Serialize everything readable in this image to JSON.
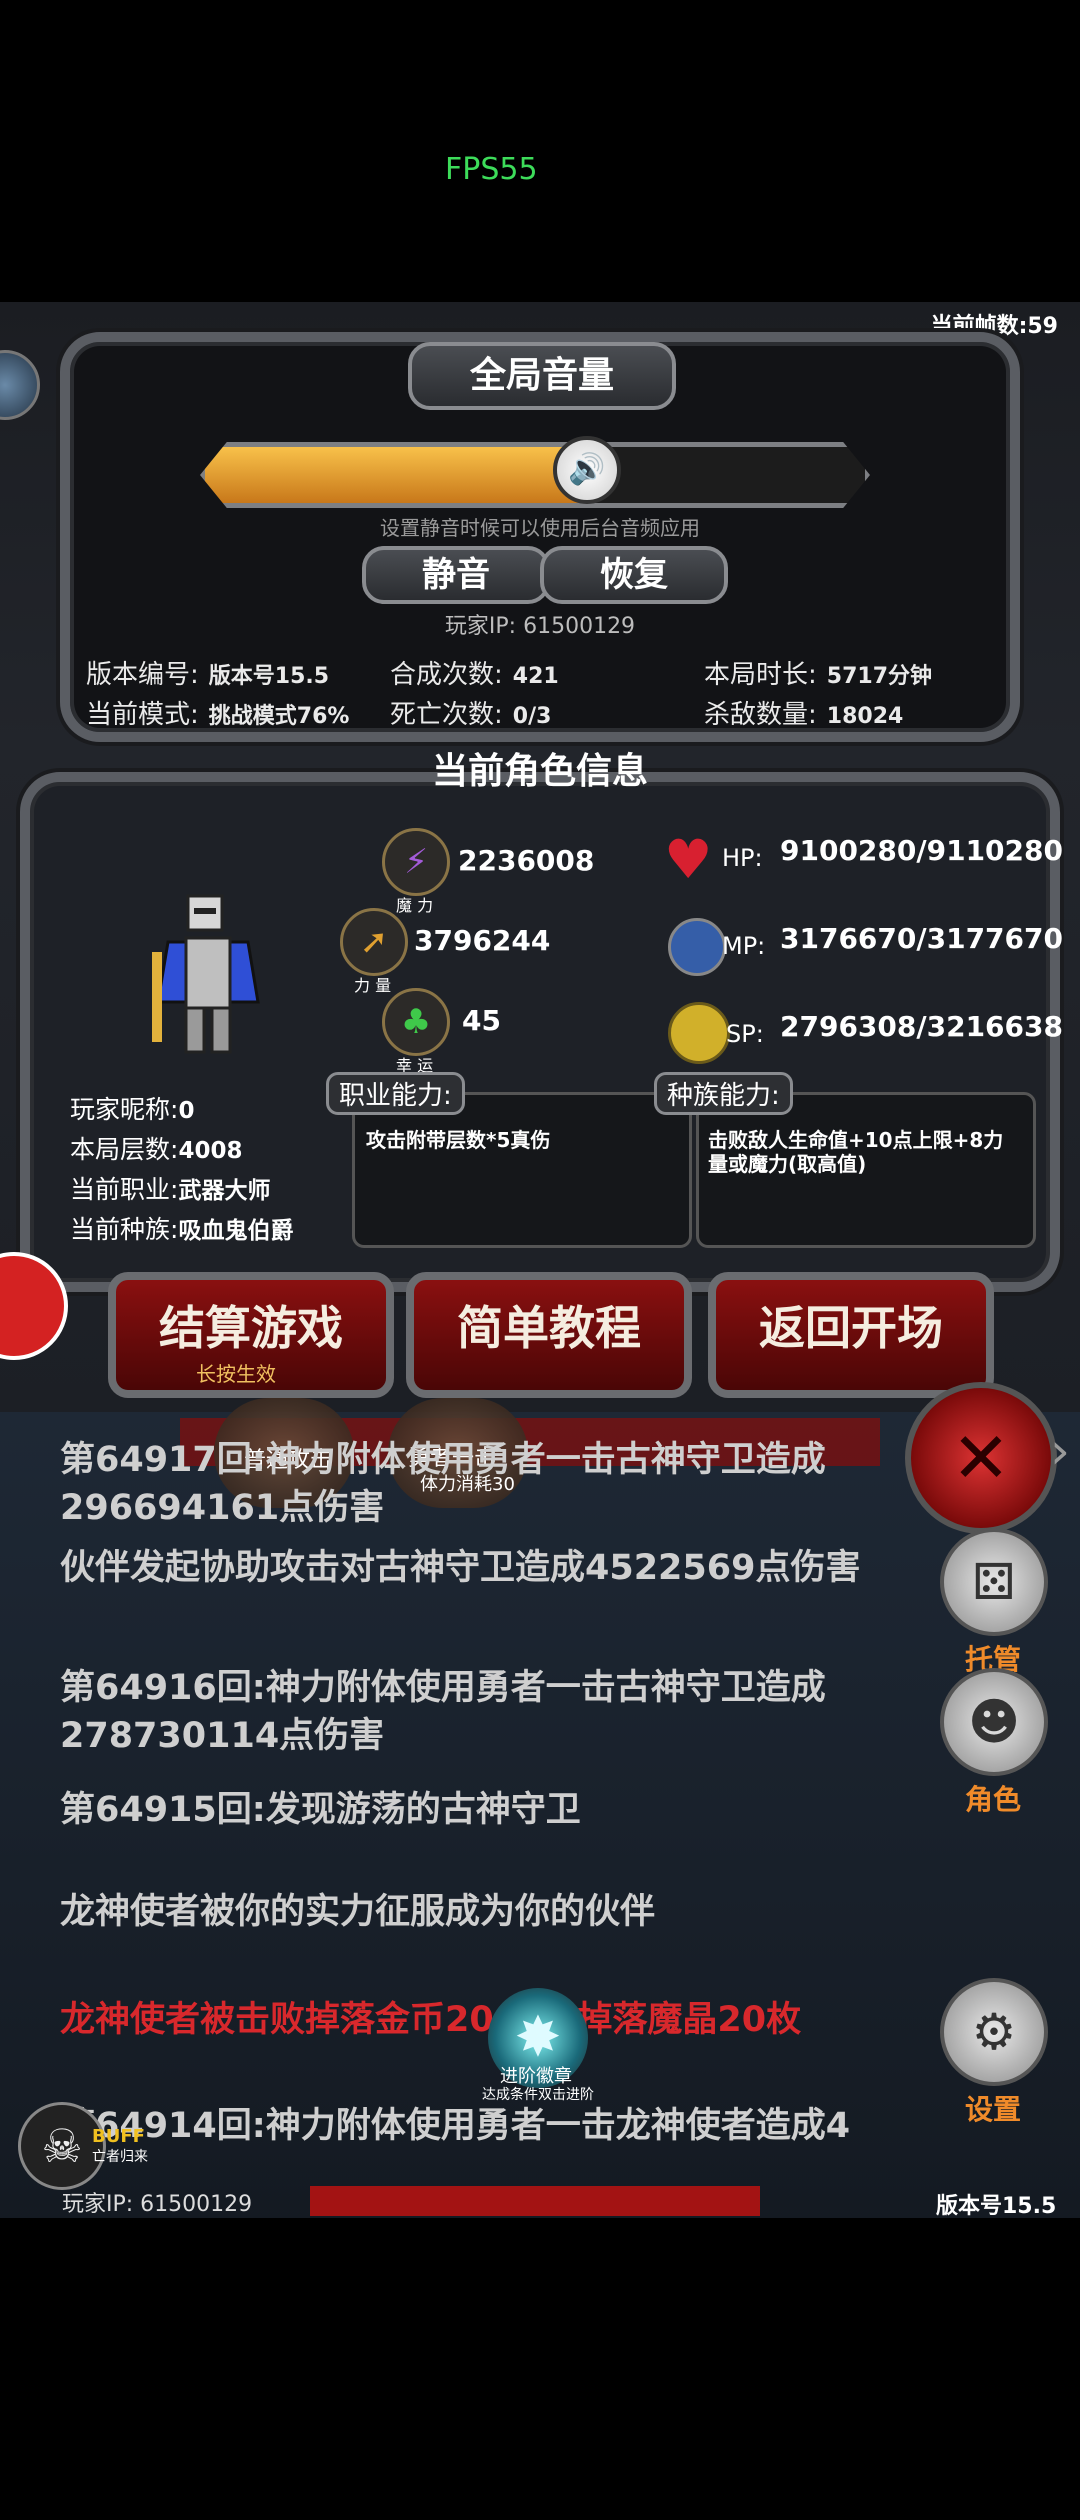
{
  "fps": "FPS55",
  "frame_count": "当前帧数:59",
  "volume": {
    "title": "全局音量",
    "level_percent": 58,
    "speaker_icon": "speaker-icon",
    "hint": "设置静音时候可以使用后台音频应用",
    "mute_label": "静音",
    "restore_label": "恢复"
  },
  "player_ip": "玩家IP:  61500129",
  "stats": {
    "version_label": "版本编号:",
    "version_value": "版本号15.5",
    "mode_label": "当前模式:",
    "mode_value": "挑战模式76%",
    "craft_label": "合成次数:",
    "craft_value": "421",
    "death_label": "死亡次数:",
    "death_value": "0/3",
    "duration_label": "本局时长:",
    "duration_value": "5717分钟",
    "kills_label": "杀敌数量:",
    "kills_value": "18024"
  },
  "char_title": "当前角色信息",
  "attrs": {
    "magic_value": "2236008",
    "magic_label": "魔 力",
    "power_value": "3796244",
    "power_label": "力 量",
    "luck_value": "45",
    "luck_label": "幸 运"
  },
  "resources": {
    "hp_label": "HP:",
    "hp_value": "9100280/9110280",
    "mp_label": "MP:",
    "mp_value": "3176670/3177670",
    "sp_label": "SP:",
    "sp_value": "2796308/3216638"
  },
  "player": {
    "nick_label": "玩家昵称:",
    "nick_value": "0",
    "floor_label": "本局层数:",
    "floor_value": "4008",
    "job_label": "当前职业:",
    "job_value": "武器大师",
    "race_label": "当前种族:",
    "race_value": "吸血鬼伯爵"
  },
  "abilities": {
    "job_tag": "职业能力:",
    "job_text": "攻击附带层数*5真伤",
    "race_tag": "种族能力:",
    "race_text": "击败敌人生命值+10点上限+8力量或魔力(取高值)"
  },
  "buttons": {
    "settle": "结算游戏",
    "settle_sub": "长按生效",
    "tutorial": "简单教程",
    "back": "返回开场"
  },
  "skills": {
    "normal_attack": "普通攻击",
    "hero_strike": "勇者一击",
    "hero_strike_cost": "体力消耗30",
    "advance_badge": "进阶徽章",
    "advance_hint": "达成条件双击进阶"
  },
  "log": [
    {
      "text": "第64917回:神力附体使用勇者一击古神守卫造成296694161点伤害",
      "color": "#cfcfcf"
    },
    {
      "text": "伙伴发起协助攻击对古神守卫造成4522569点伤害",
      "color": "#cfcfcf"
    },
    {
      "text": "第64916回:神力附体使用勇者一击古神守卫造成278730114点伤害",
      "color": "#cfcfcf"
    },
    {
      "text": "第64915回:发现游荡的古神守卫",
      "color": "#cfcfcf"
    },
    {
      "text": "龙神使者被你的实力征服成为你的伙伴",
      "color": "#cfcfcf"
    },
    {
      "text": "龙神使者被击败掉落金币2008枚掉落魔晶20枚",
      "color": "#d8282c"
    },
    {
      "text": "第64914回:神力附体使用勇者一击龙神使者造成4",
      "color": "#cfcfcf"
    }
  ],
  "side_menu": {
    "auto_label": "托管",
    "role_label": "角色",
    "settings_label": "设置"
  },
  "buff": {
    "label": "BUFF",
    "sub": "亡者归来"
  },
  "footer": {
    "ip": "玩家IP:  61500129",
    "version": "版本号15.5"
  }
}
